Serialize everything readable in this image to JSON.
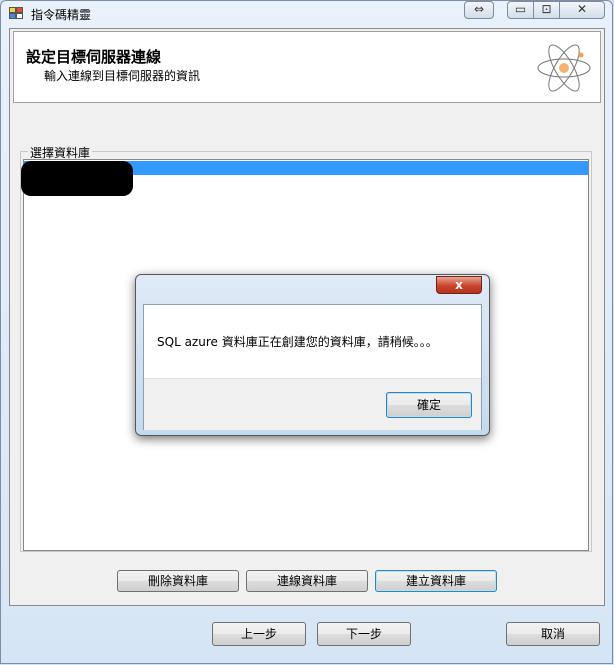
{
  "window": {
    "title": "指令碼精靈",
    "buttons": {
      "restore": "⇔",
      "minimize": "▭",
      "maximize": "⊡",
      "close": "✕"
    }
  },
  "header": {
    "title": "設定目標伺服器連線",
    "subtitle": "輸入連線到目標伺服器的資訊",
    "icon": "atom-icon"
  },
  "database_group": {
    "legend": "選擇資料庫",
    "items": [
      {
        "label": "",
        "selected": true,
        "redacted": true
      }
    ]
  },
  "actions": {
    "delete_db": "刪除資料庫",
    "connect_db": "連線資料庫",
    "create_db": "建立資料庫"
  },
  "nav": {
    "prev": "上一步",
    "next": "下一步",
    "cancel": "取消"
  },
  "dialog": {
    "close": "x",
    "message": "SQL azure 資料庫正在創建您的資料庫，請稍候。。。",
    "ok": "確定"
  },
  "colors": {
    "selection": "#3399ff",
    "dialog_close": "#c9452b"
  }
}
